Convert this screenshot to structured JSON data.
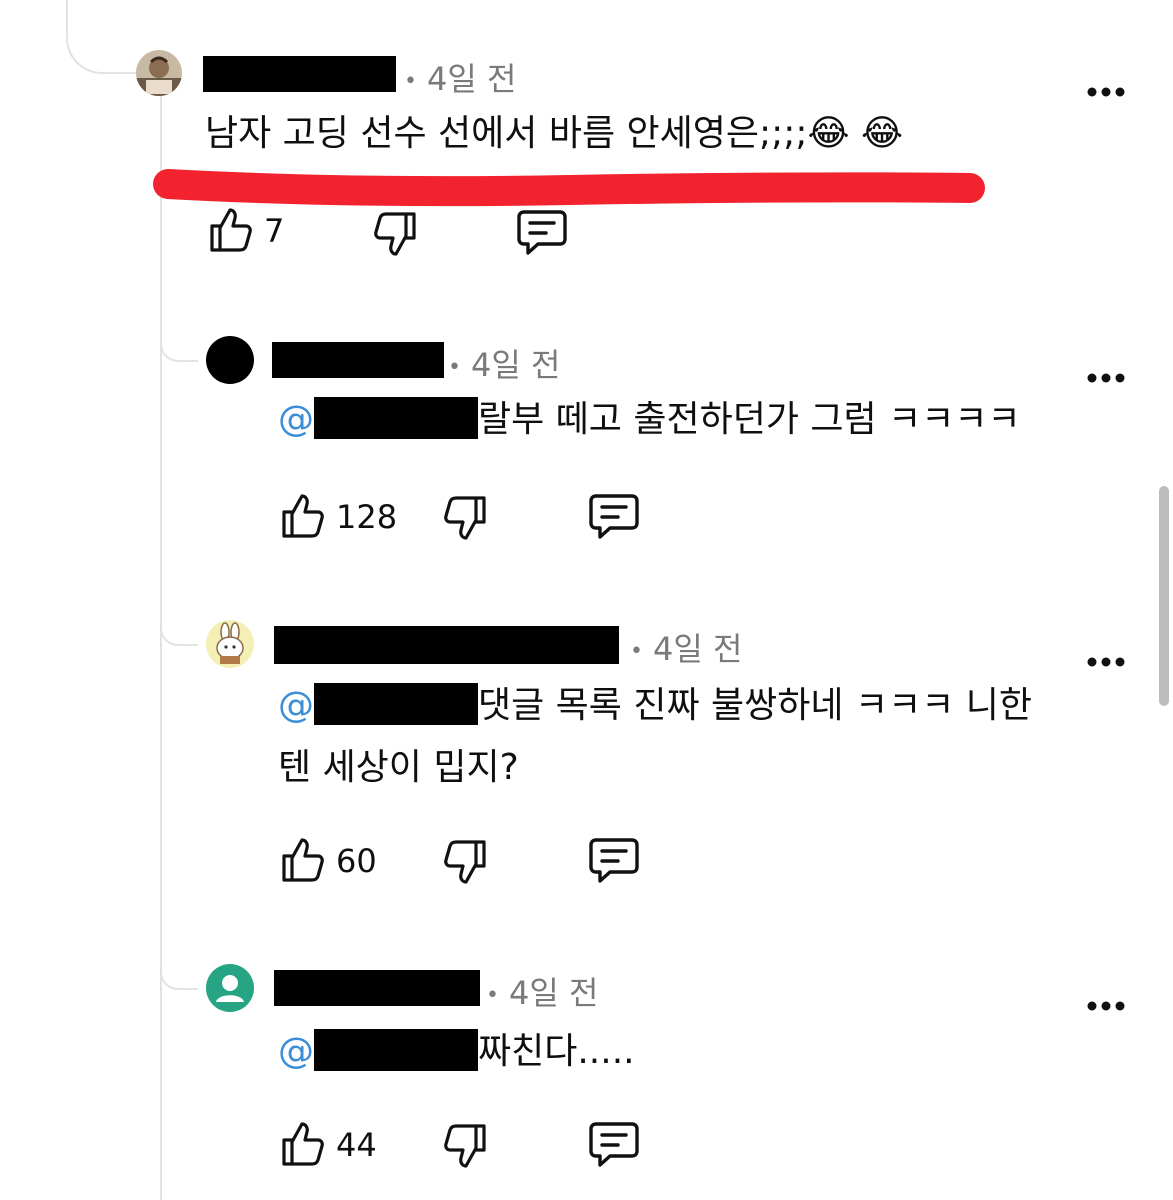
{
  "comments": [
    {
      "time": "4일 전",
      "text": "남자 고딩 선수 선에서 바름 안세영은;;;;",
      "emoji": "😂 😂",
      "likes": "7"
    },
    {
      "time": "4일 전",
      "mention": "@",
      "text": "랄부 떼고 출전하던가 그럼 ㅋㅋㅋㅋ",
      "likes": "128"
    },
    {
      "time": "4일 전",
      "mention": "@",
      "text": "댓글 목록 진짜 불쌍하네 ㅋㅋㅋ 니한",
      "text2": "텐 세상이 밉지?",
      "likes": "60"
    },
    {
      "time": "4일 전",
      "mention": "@",
      "text": "짜친다.....",
      "likes": "44"
    }
  ],
  "colors": {
    "mention": "#3b8fd6",
    "highlight": "#f2232f",
    "meta": "#7a7a7a"
  }
}
